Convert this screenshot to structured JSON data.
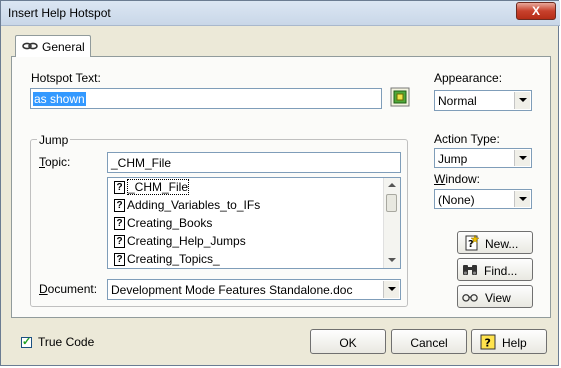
{
  "window": {
    "title": "Insert Help Hotspot",
    "close_label": "X"
  },
  "tabs": [
    {
      "label": "General"
    }
  ],
  "hotspot_text": {
    "label": "Hotspot Text:",
    "value": "as shown"
  },
  "appearance": {
    "label": "Appearance:",
    "value": "Normal"
  },
  "jump_group": {
    "label": "Jump"
  },
  "topic": {
    "label": "Topic:",
    "value": "_CHM_File",
    "items": [
      "_CHM_File",
      "Adding_Variables_to_IFs",
      "Creating_Books",
      "Creating_Help_Jumps",
      "Creating_Topics_"
    ]
  },
  "document": {
    "label": "Document:",
    "value": "Development Mode Features Standalone.doc"
  },
  "action_type": {
    "label": "Action Type:",
    "value": "Jump"
  },
  "window_field": {
    "label": "Window:",
    "value": "(None)"
  },
  "buttons": {
    "new": "New...",
    "find": "Find...",
    "view": "View",
    "ok": "OK",
    "cancel": "Cancel",
    "help": "Help"
  },
  "true_code": {
    "label": "True Code",
    "checked": true
  },
  "colors": {
    "selection": "#3399ff",
    "dialog_bg": "#ece9d8",
    "panel_bg": "#fbfbf9"
  },
  "icons": [
    "link-icon",
    "hotspot-picker-icon",
    "help-topic-icon",
    "new-icon",
    "find-binoculars-icon",
    "view-glasses-icon",
    "help-icon"
  ]
}
